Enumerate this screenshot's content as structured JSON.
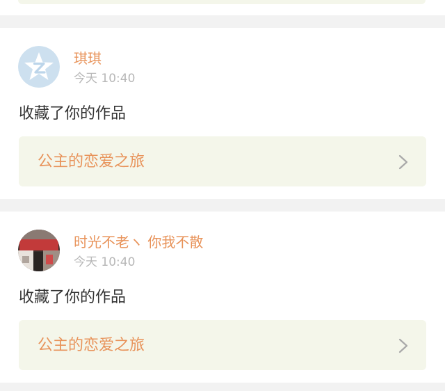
{
  "notifications": [
    {
      "user": {
        "name": "琪琪",
        "avatar_icon": "qq-default-avatar-icon"
      },
      "time": "今天 10:40",
      "action": "收藏了你的作品",
      "work_title": "公主的恋爱之旅"
    },
    {
      "user": {
        "name": "时光不老ヽ 你我不散",
        "avatar_icon": "photo-avatar"
      },
      "time": "今天 10:40",
      "action": "收藏了你的作品",
      "work_title": "公主的恋爱之旅"
    }
  ],
  "colors": {
    "accent": "#e8935a",
    "muted": "#b7b7b7",
    "text": "#333333",
    "link_bg": "#f4f6ea",
    "page_bg": "#f2f2f2"
  }
}
